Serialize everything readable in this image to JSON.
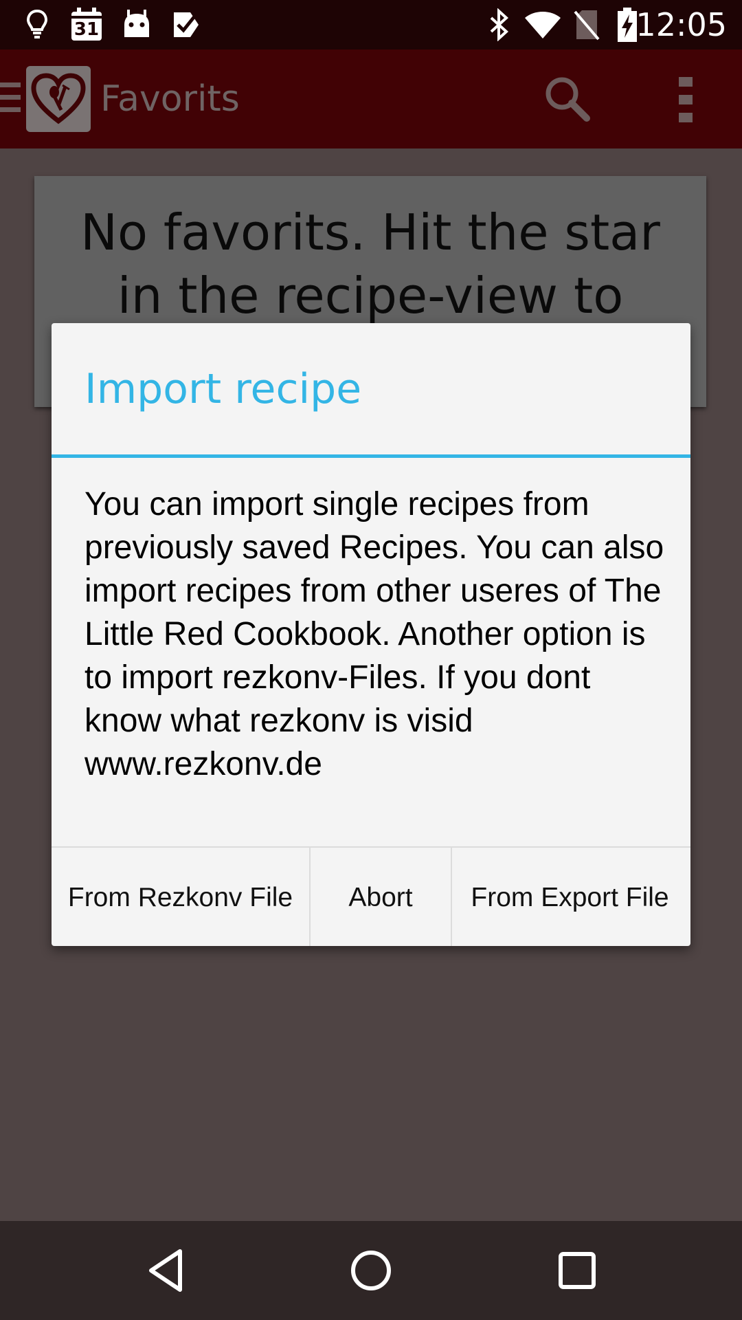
{
  "status_bar": {
    "time": "12:05",
    "left_icons": [
      "lightbulb-icon",
      "calendar-icon",
      "android-icon",
      "task-check-icon"
    ],
    "calendar_day": "31",
    "right_icons": [
      "bluetooth-icon",
      "wifi-icon",
      "no-sim-icon",
      "battery-charging-icon"
    ]
  },
  "app_bar": {
    "title": "Favorits",
    "logo_icon": "heart-cutlery-logo",
    "actions": [
      "search-icon",
      "overflow-menu-icon"
    ]
  },
  "empty_state": {
    "message": "No favorits. Hit the star in the recipe-view to mark it"
  },
  "dialog": {
    "title": "Import recipe",
    "message": "You can import single recipes from previously saved Recipes. You can also import recipes from other useres of The Little Red Cookbook. Another option is to import rezkonv-Files. If you dont know what rezkonv is visid www.rezkonv.de",
    "buttons": {
      "rezkonv": "From Rezkonv File",
      "abort": "Abort",
      "export": "From Export File"
    }
  },
  "nav_bar": {
    "buttons": [
      "back-icon",
      "home-icon",
      "recents-icon"
    ]
  },
  "colors": {
    "accent": "#33b5e5",
    "app_bar": "#410205",
    "status_bar": "#1e0405",
    "scrim_background": "#4f4444",
    "dialog_background": "#f4f4f4"
  }
}
